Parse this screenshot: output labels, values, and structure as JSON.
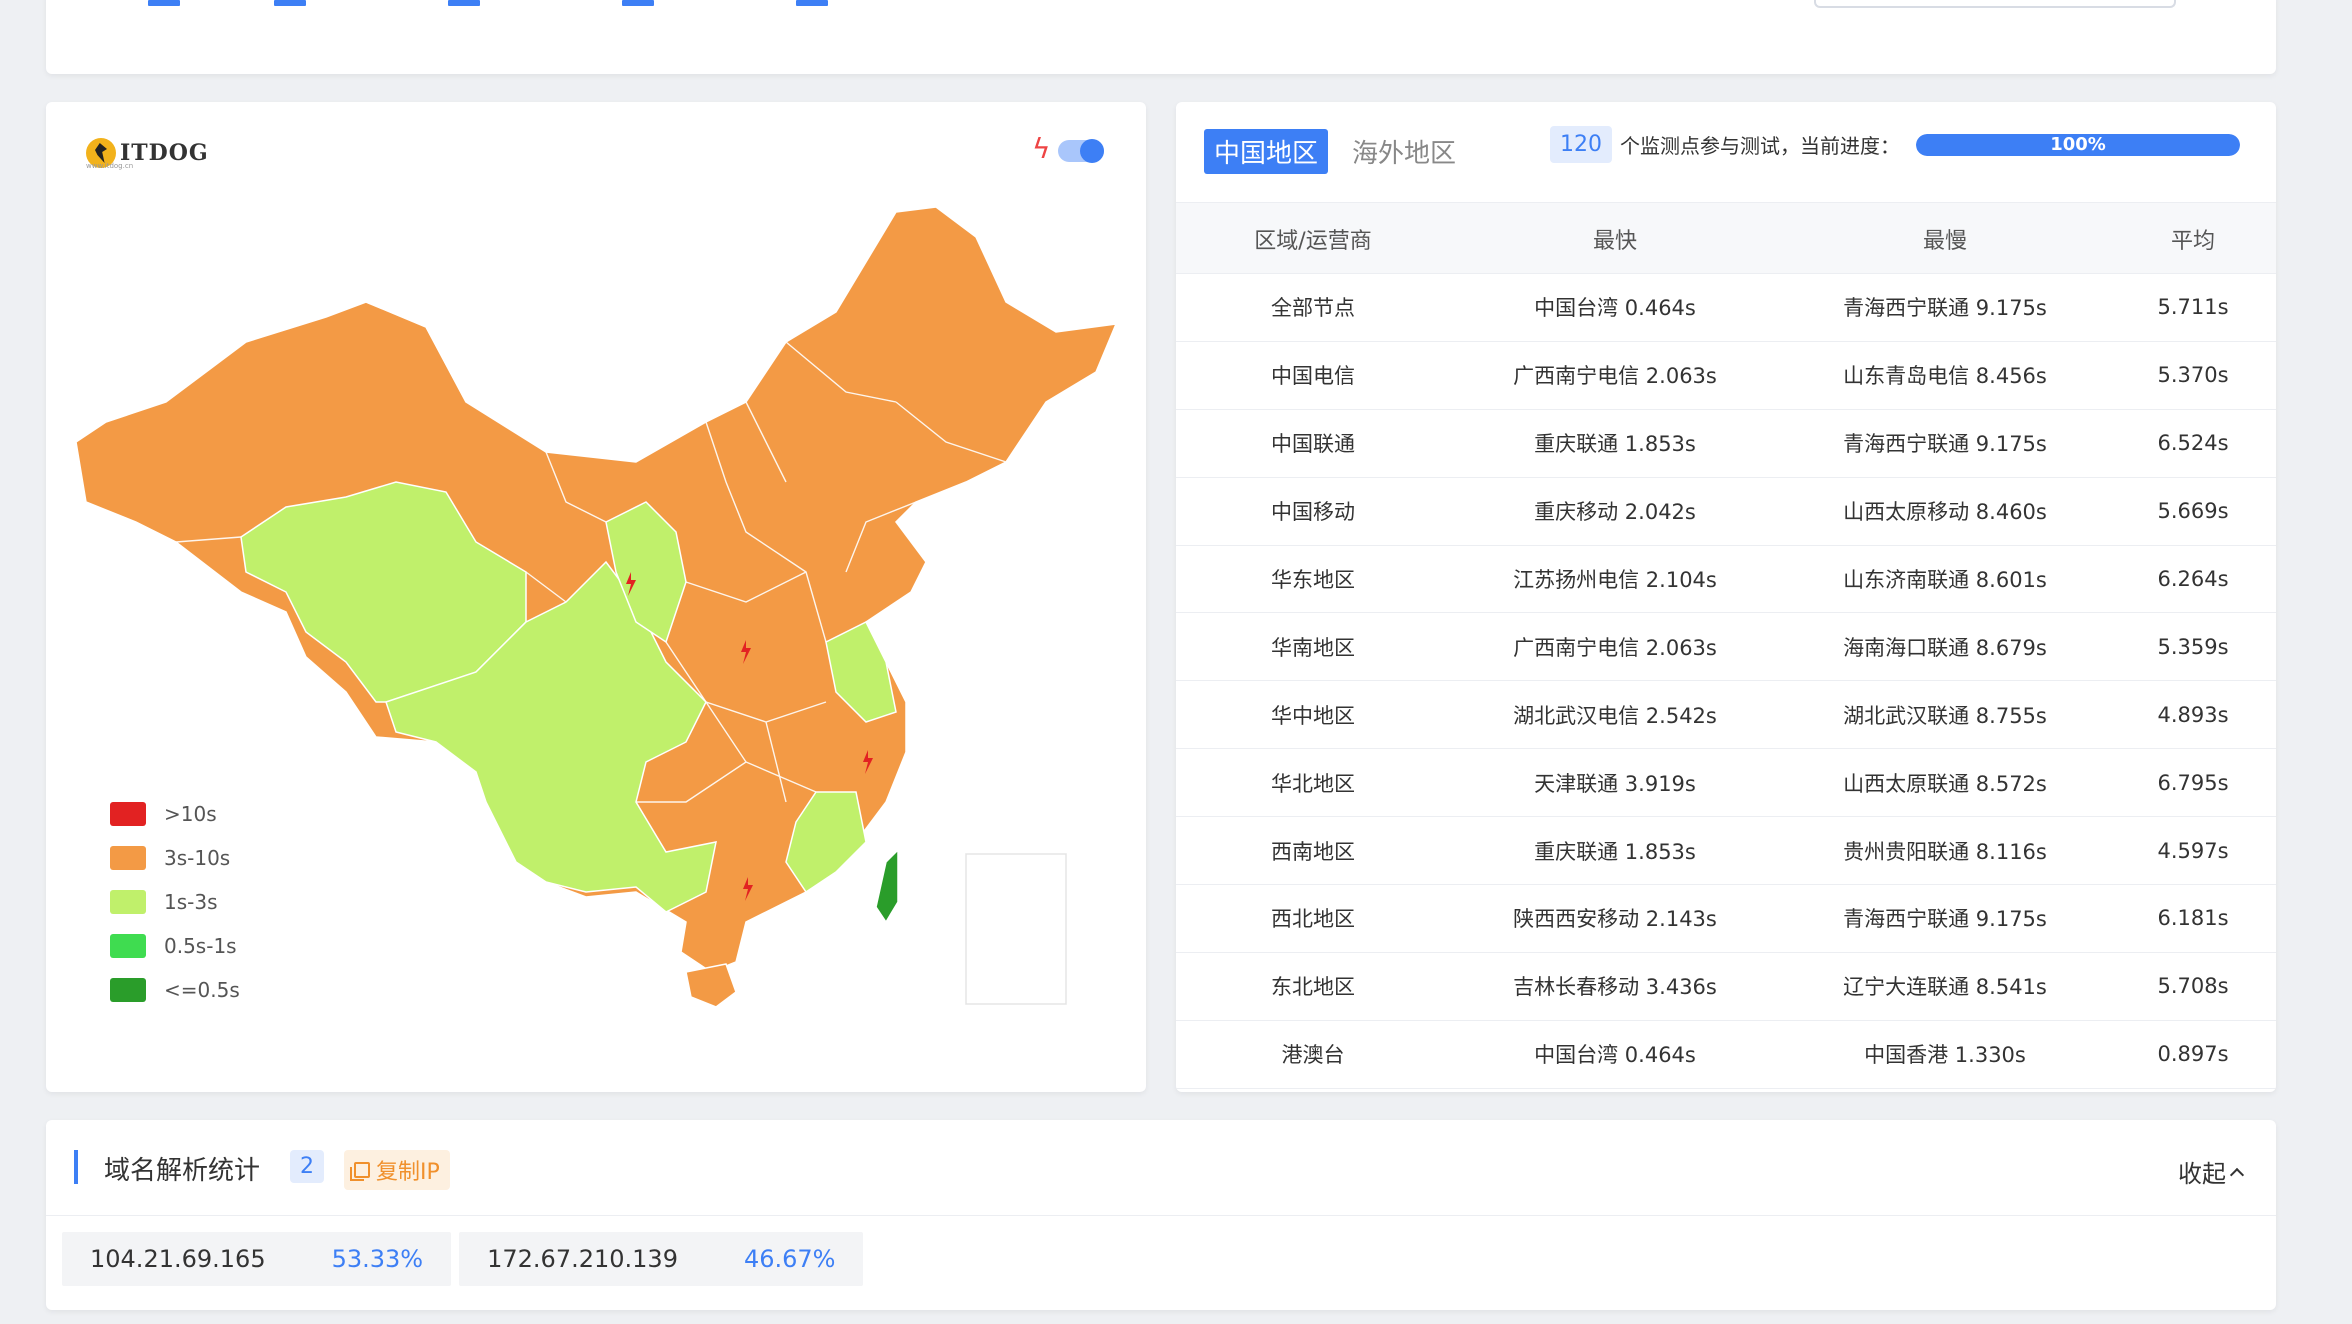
{
  "colors": {
    "accent": "#3d7ff5",
    "over10s": "#e22222",
    "s3to10": "#f39a45",
    "s1to3": "#c0f06b",
    "s05to1": "#3fdc50",
    "under05": "#2a9d2a",
    "taiwan": "#2a9d2a"
  },
  "map": {
    "logo_text": "ITDOG",
    "logo_sub": "www.itdog.cn",
    "speed_toggle_icon": "lightning-icon",
    "speed_toggle_on": true,
    "legend": [
      {
        "label": ">10s",
        "color": "#e22222"
      },
      {
        "label": "3s-10s",
        "color": "#f39a45"
      },
      {
        "label": "1s-3s",
        "color": "#c0f06b"
      },
      {
        "label": "0.5s-1s",
        "color": "#3fdc50"
      },
      {
        "label": "<=0.5s",
        "color": "#2a9d2a"
      }
    ]
  },
  "stats": {
    "tabs": [
      {
        "label": "中国地区",
        "active": true
      },
      {
        "label": "海外地区",
        "active": false
      }
    ],
    "node_count": "120",
    "progress_text": "个监测点参与测试，当前进度：",
    "progress_label": "100%",
    "progress_value": 100,
    "columns": [
      "区域/运营商",
      "最快",
      "最慢",
      "平均"
    ],
    "rows": [
      [
        "全部节点",
        "中国台湾 0.464s",
        "青海西宁联通 9.175s",
        "5.711s"
      ],
      [
        "中国电信",
        "广西南宁电信 2.063s",
        "山东青岛电信 8.456s",
        "5.370s"
      ],
      [
        "中国联通",
        "重庆联通 1.853s",
        "青海西宁联通 9.175s",
        "6.524s"
      ],
      [
        "中国移动",
        "重庆移动 2.042s",
        "山西太原移动 8.460s",
        "5.669s"
      ],
      [
        "华东地区",
        "江苏扬州电信 2.104s",
        "山东济南联通 8.601s",
        "6.264s"
      ],
      [
        "华南地区",
        "广西南宁电信 2.063s",
        "海南海口联通 8.679s",
        "5.359s"
      ],
      [
        "华中地区",
        "湖北武汉电信 2.542s",
        "湖北武汉联通 8.755s",
        "4.893s"
      ],
      [
        "华北地区",
        "天津联通 3.919s",
        "山西太原联通 8.572s",
        "6.795s"
      ],
      [
        "西南地区",
        "重庆联通 1.853s",
        "贵州贵阳联通 8.116s",
        "4.597s"
      ],
      [
        "西北地区",
        "陕西西安移动 2.143s",
        "青海西宁联通 9.175s",
        "6.181s"
      ],
      [
        "东北地区",
        "吉林长春移动 3.436s",
        "辽宁大连联通 8.541s",
        "5.708s"
      ],
      [
        "港澳台",
        "中国台湾 0.464s",
        "中国香港 1.330s",
        "0.897s"
      ]
    ]
  },
  "dns": {
    "title": "域名解析统计",
    "count": "2",
    "copy_label": "复制IP",
    "collapse_label": "收起",
    "ips": [
      {
        "ip": "104.21.69.165",
        "pct": "53.33%"
      },
      {
        "ip": "172.67.210.139",
        "pct": "46.67%"
      }
    ]
  }
}
